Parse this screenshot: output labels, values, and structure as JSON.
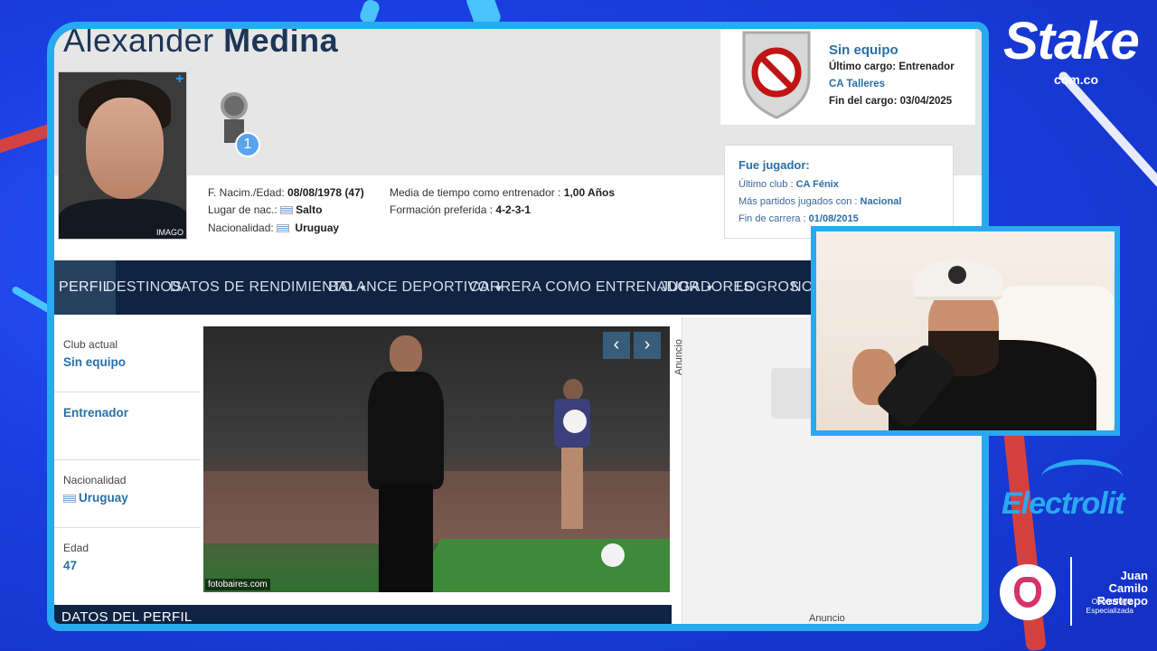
{
  "profile": {
    "first_name": "Alexander",
    "last_name": "Medina",
    "photo_credit": "IMAGO",
    "add_label": "+",
    "trophy_count": "1"
  },
  "details": {
    "birth_label": "F. Nacim./Edad:",
    "birth_value": "08/08/1978 (47)",
    "place_label": "Lugar de nac.:",
    "place_value": "Salto",
    "nationality_label": "Nacionalidad:",
    "nationality_value": "Uruguay",
    "avg_time_label": "Media de tiempo como entrenador :",
    "avg_time_value": "1,00 Años",
    "formation_label": "Formación preferida :",
    "formation_value": "4-2-3-1"
  },
  "club_box": {
    "title": "Sin equipo",
    "last_role_label": "Último cargo:",
    "last_role_value": "Entrenador",
    "club": "CA Talleres",
    "end_label": "Fin del cargo:",
    "end_value": "03/04/2025"
  },
  "player_box": {
    "title": "Fue jugador:",
    "last_club_label": "Último club :",
    "last_club_value": "CA Fénix",
    "most_matches_label": "Más partidos jugados con :",
    "most_matches_value": "Nacional",
    "career_end_label": "Fin de carrera :",
    "career_end_value": "01/08/2015"
  },
  "nav": {
    "items": [
      {
        "label": "PERFIL"
      },
      {
        "label": "DESTINOS"
      },
      {
        "label": "DATOS DE RENDIMIENTO"
      },
      {
        "label": "BALANCE DEPORTIVO"
      },
      {
        "label": "CARRERA COMO ENTRENADOR"
      },
      {
        "label": "JUGADORES"
      },
      {
        "label": "LOGROS"
      },
      {
        "label": "NOT"
      }
    ],
    "caret": "▼"
  },
  "sidebar": {
    "club_label": "Club actual",
    "club_value": "Sin equipo",
    "role_value": "Entrenador",
    "nationality_label": "Nacionalidad",
    "nationality_value": "Uruguay",
    "age_label": "Edad",
    "age_value": "47"
  },
  "photo": {
    "credit": "fotobaires.com",
    "prev": "‹",
    "next": "›"
  },
  "ad": {
    "label": "Anuncio",
    "bottom_label": "Anuncio"
  },
  "section": {
    "title": "DATOS DEL PERFIL"
  },
  "sponsors": {
    "stake": "Stake",
    "stake_domain": "com.co",
    "electrolit": "Electrolit",
    "dentist_name_1": "Juan Camilo",
    "dentist_name_2": "Restrepo",
    "dentist_sub_1": "Odontología",
    "dentist_sub_2": "Especializada"
  },
  "colors": {
    "background": "#1a3fe0",
    "frame": "#29a9f0",
    "nav": "#0f2342",
    "link": "#2a6fa8",
    "accent_red": "#e8432f"
  }
}
